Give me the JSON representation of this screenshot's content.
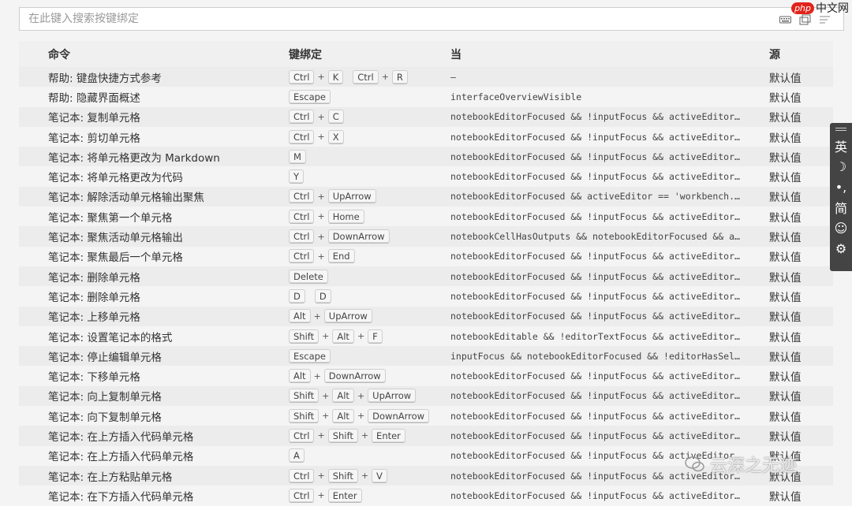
{
  "search": {
    "placeholder": "在此键入搜索按键绑定"
  },
  "watermark_top": {
    "badge": "php",
    "text": "中文网"
  },
  "watermark_bottom": {
    "text": "云深之无迹"
  },
  "columns": {
    "command": "命令",
    "keybinding": "键绑定",
    "when": "当",
    "source": "源"
  },
  "rows": [
    {
      "command": "帮助: 键盘快捷方式参考",
      "keys": [
        [
          "Ctrl",
          "K"
        ],
        [
          "Ctrl",
          "R"
        ]
      ],
      "when": "—",
      "source": "默认值"
    },
    {
      "command": "帮助: 隐藏界面概述",
      "keys": [
        [
          "Escape"
        ]
      ],
      "when": "interfaceOverviewVisible",
      "source": "默认值"
    },
    {
      "command": "笔记本: 复制单元格",
      "keys": [
        [
          "Ctrl",
          "C"
        ]
      ],
      "when": "notebookEditorFocused && !inputFocus && activeEditor == '…",
      "source": "默认值"
    },
    {
      "command": "笔记本: 剪切单元格",
      "keys": [
        [
          "Ctrl",
          "X"
        ]
      ],
      "when": "notebookEditorFocused && !inputFocus && activeEditor == '…",
      "source": "默认值"
    },
    {
      "command": "笔记本: 将单元格更改为 Markdown",
      "keys": [
        [
          "M"
        ]
      ],
      "when": "notebookEditorFocused && !inputFocus && activeEditor == '…",
      "source": "默认值"
    },
    {
      "command": "笔记本: 将单元格更改为代码",
      "keys": [
        [
          "Y"
        ]
      ],
      "when": "notebookEditorFocused && !inputFocus && activeEditor == '…",
      "source": "默认值"
    },
    {
      "command": "笔记本: 解除活动单元格输出聚焦",
      "keys": [
        [
          "Ctrl",
          "UpArrow"
        ]
      ],
      "when": "notebookEditorFocused && activeEditor == 'workbench.edito…",
      "source": "默认值"
    },
    {
      "command": "笔记本: 聚焦第一个单元格",
      "keys": [
        [
          "Ctrl",
          "Home"
        ]
      ],
      "when": "notebookEditorFocused && !inputFocus && activeEditor == '…",
      "source": "默认值"
    },
    {
      "command": "笔记本: 聚焦活动单元格输出",
      "keys": [
        [
          "Ctrl",
          "DownArrow"
        ]
      ],
      "when": "notebookCellHasOutputs && notebookEditorFocused && active…",
      "source": "默认值"
    },
    {
      "command": "笔记本: 聚焦最后一个单元格",
      "keys": [
        [
          "Ctrl",
          "End"
        ]
      ],
      "when": "notebookEditorFocused && !inputFocus && activeEditor == '…",
      "source": "默认值"
    },
    {
      "command": "笔记本: 删除单元格",
      "keys": [
        [
          "Delete"
        ]
      ],
      "when": "notebookEditorFocused && !inputFocus && activeEditor == '…",
      "source": "默认值"
    },
    {
      "command": "笔记本: 删除单元格",
      "keys": [
        [
          "D"
        ],
        [
          "D"
        ]
      ],
      "when": "notebookEditorFocused && !inputFocus && activeEditor == '…",
      "source": "默认值"
    },
    {
      "command": "笔记本: 上移单元格",
      "keys": [
        [
          "Alt",
          "UpArrow"
        ]
      ],
      "when": "notebookEditorFocused && !inputFocus && activeEditor == '…",
      "source": "默认值"
    },
    {
      "command": "笔记本: 设置笔记本的格式",
      "keys": [
        [
          "Shift",
          "Alt",
          "F"
        ]
      ],
      "when": "notebookEditable && !editorTextFocus && activeEditor == '…",
      "source": "默认值"
    },
    {
      "command": "笔记本: 停止编辑单元格",
      "keys": [
        [
          "Escape"
        ]
      ],
      "when": "inputFocus && notebookEditorFocused && !editorHasSelectio…",
      "source": "默认值"
    },
    {
      "command": "笔记本: 下移单元格",
      "keys": [
        [
          "Alt",
          "DownArrow"
        ]
      ],
      "when": "notebookEditorFocused && !inputFocus && activeEditor == '…",
      "source": "默认值"
    },
    {
      "command": "笔记本: 向上复制单元格",
      "keys": [
        [
          "Shift",
          "Alt",
          "UpArrow"
        ]
      ],
      "when": "notebookEditorFocused && !inputFocus && activeEditor == '…",
      "source": "默认值"
    },
    {
      "command": "笔记本: 向下复制单元格",
      "keys": [
        [
          "Shift",
          "Alt",
          "DownArrow"
        ]
      ],
      "when": "notebookEditorFocused && !inputFocus && activeEditor == '…",
      "source": "默认值"
    },
    {
      "command": "笔记本: 在上方插入代码单元格",
      "keys": [
        [
          "Ctrl",
          "Shift",
          "Enter"
        ]
      ],
      "when": "notebookEditorFocused && !inputFocus && activeEditor == '…",
      "source": "默认值"
    },
    {
      "command": "笔记本: 在上方插入代码单元格",
      "keys": [
        [
          "A"
        ]
      ],
      "when": "notebookEditorFocused && !inputFocus && activeEditor == '…",
      "source": "默认值"
    },
    {
      "command": "笔记本: 在上方粘贴单元格",
      "keys": [
        [
          "Ctrl",
          "Shift",
          "V"
        ]
      ],
      "when": "notebookEditorFocused && !inputFocus && activeEditor == '…",
      "source": "默认值"
    },
    {
      "command": "笔记本: 在下方插入代码单元格",
      "keys": [
        [
          "Ctrl",
          "Enter"
        ]
      ],
      "when": "notebookEditorFocused && !inputFocus && activeEditor == '…",
      "source": "默认值"
    }
  ],
  "ime_toolbar": {
    "items": [
      "英",
      "☽",
      "•,",
      "简",
      "☺",
      "⚙"
    ]
  },
  "icons": {
    "search_keyboard": "keyboard-icon",
    "search_record": "record-keys-icon",
    "search_sort": "sort-icon"
  }
}
